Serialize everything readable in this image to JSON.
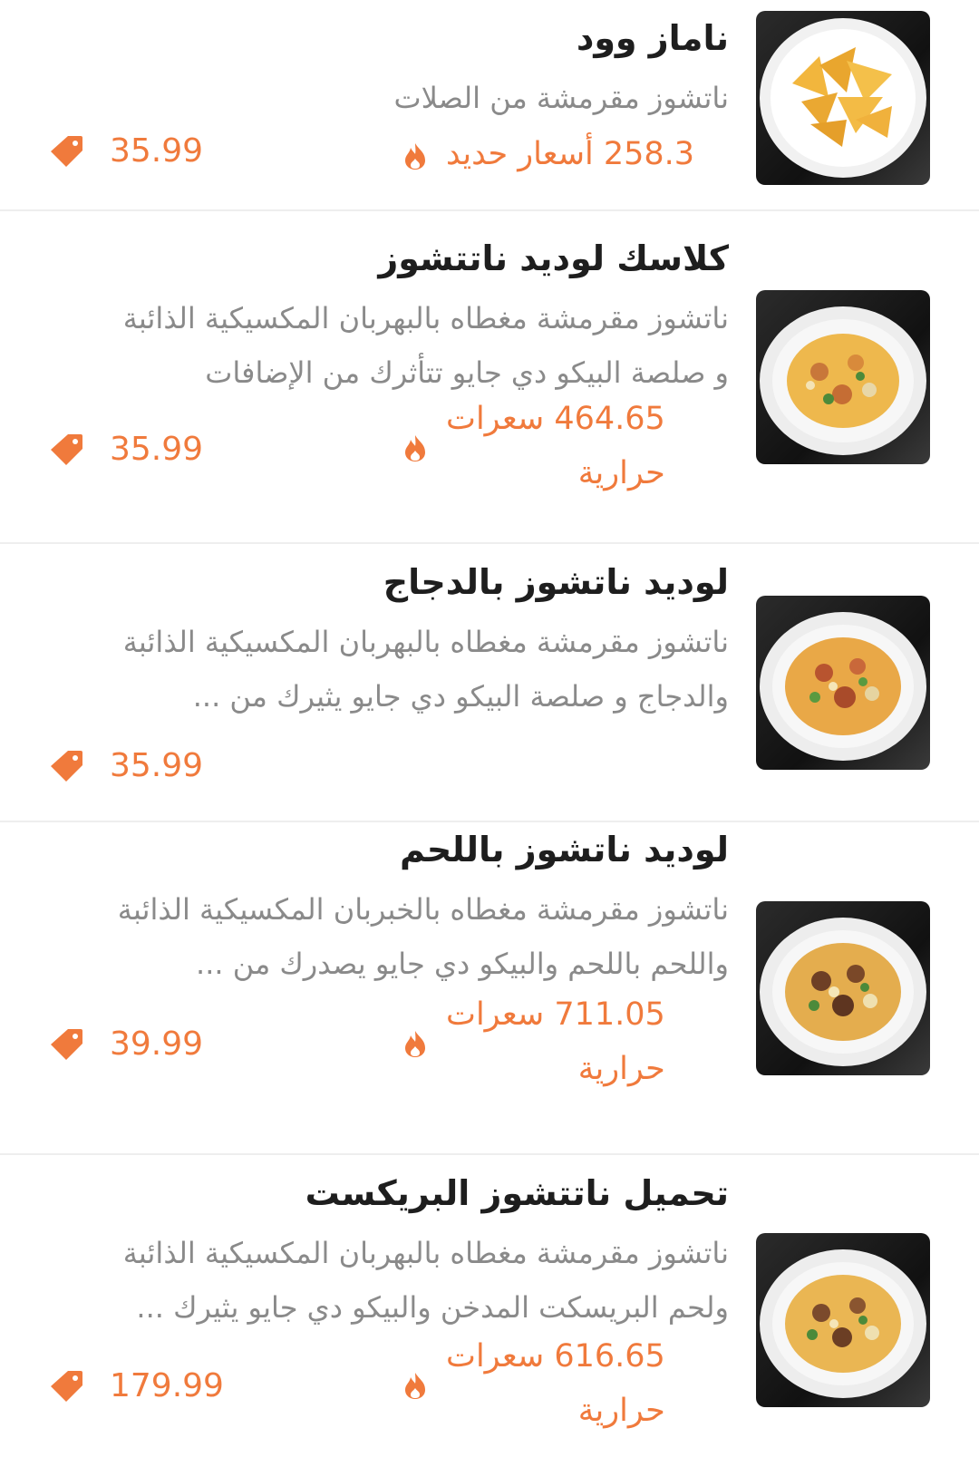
{
  "items": [
    {
      "title": "ناماز وود",
      "description": "ناتشوز مقرمشة من الصلات",
      "calories": "258.3 أسعار حديد",
      "price": "35.99"
    },
    {
      "title": "كلاسك لوديد ناتتشوز",
      "description": "ناتشوز مقرمشة مغطاه بالبهربان المكسيكية الذائبة\nو صلصة البيكو دي جايو تتأثرك من الإضافات",
      "calories": "464.65 سعرات\nحرارية",
      "price": "35.99"
    },
    {
      "title": "لوديد ناتشوز بالدجاج",
      "description": "ناتشوز مقرمشة مغطاه بالبهربان المكسيكية الذائبة\nوالدجاج و صلصة البيكو دي جايو يثيرك من ...",
      "calories": "",
      "price": "35.99"
    },
    {
      "title": "لوديد ناتشوز باللحم",
      "description": "ناتشوز مقرمشة مغطاه بالخبربان المكسيكية الذائبة\nواللحم باللحم والبيكو دي جايو يصدرك من ...",
      "calories": "711.05 سعرات\nحرارية",
      "price": "39.99"
    },
    {
      "title": "تحميل ناتتشوز البريكست",
      "description": "ناتشوز مقرمشة مغطاه بالبهربان المكسيكية الذائبة\nولحم البريسكت المدخن والبيكو دي جايو يثيرك ...",
      "calories": "616.65 سعرات\nحرارية",
      "price": "179.99"
    }
  ],
  "colors": {
    "accent": "#f07a3c",
    "title": "#1e1e1e",
    "desc": "#8a8a8a",
    "divider": "#eeeeee"
  },
  "icons": {
    "price": "price-tag-icon",
    "calories": "flame-icon",
    "image": "nachos-plate-image"
  }
}
